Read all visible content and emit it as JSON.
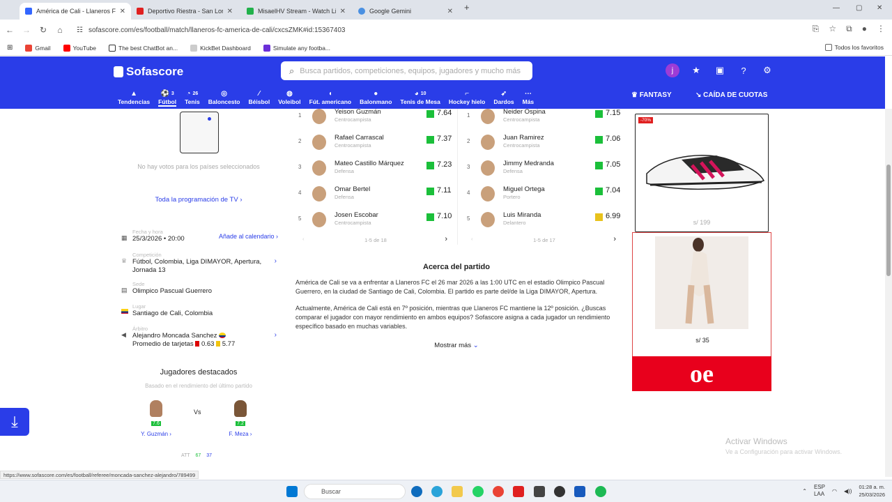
{
  "browser": {
    "tabs": [
      {
        "title": "América de Cali - Llaneros FC e",
        "color": "#3366ff",
        "active": true
      },
      {
        "title": "Deportivo Riestra - San Lorenzo",
        "color": "#e02020",
        "active": false
      },
      {
        "title": "MisaelHV Stream - Watch Live",
        "color": "#21b14b",
        "active": false
      },
      {
        "title": "Google Gemini",
        "color": "#4a90e2",
        "active": false
      }
    ],
    "url": "sofascore.com/es/football/match/llaneros-fc-america-de-cali/cxcsZMK#id:15367403",
    "bookmarks": [
      "Gmail",
      "YouTube",
      "The best ChatBot an...",
      "KickBet Dashboard",
      "Simulate any footba..."
    ],
    "bookmarks_folder": "Todos los favoritos",
    "status_url": "https://www.sofascore.com/es/football/referee/moncada-sanchez-alejandro/789499"
  },
  "header": {
    "logo": "Sofascore",
    "search_placeholder": "Busca partidos, competiciones, equipos, jugadores y mucho más",
    "avatar_letter": "j",
    "sports": [
      {
        "label": "Tendencias",
        "count": ""
      },
      {
        "label": "Fútbol",
        "count": "3"
      },
      {
        "label": "Tenis",
        "count": "26"
      },
      {
        "label": "Baloncesto",
        "count": ""
      },
      {
        "label": "Béisbol",
        "count": ""
      },
      {
        "label": "Voleibol",
        "count": ""
      },
      {
        "label": "Fút. americano",
        "count": ""
      },
      {
        "label": "Balonmano",
        "count": ""
      },
      {
        "label": "Tenis de Mesa",
        "count": "10"
      },
      {
        "label": "Hockey hielo",
        "count": ""
      },
      {
        "label": "Dardos",
        "count": ""
      },
      {
        "label": "Más",
        "count": ""
      }
    ],
    "fantasy": "FANTASY",
    "odds": "CAÍDA DE CUOTAS"
  },
  "left": {
    "no_votes": "No hay votos para los países seleccionados",
    "tv_link": "Toda la programación de TV",
    "date_label": "Fecha y hora",
    "date_value": "25/3/2026 • 20:00",
    "add_calendar": "Añade al calendario",
    "competition_label": "Competición",
    "competition_value": "Fútbol, Colombia, Liga DIMAYOR, Apertura, Jornada 13",
    "venue_label": "Sede",
    "venue_value": "Olimpico Pascual Guerrero",
    "place_label": "Lugar",
    "place_value": "Santiago de Cali, Colombia",
    "referee_label": "Árbitro",
    "referee_value": "Alejandro Moncada Sanchez",
    "cards_label": "Promedio de tarjetas",
    "red_cards": "0.63",
    "yellow_cards": "5.77",
    "featured_title": "Jugadores destacados",
    "featured_sub": "Basado en el rendimiento del último partido",
    "vs": "Vs",
    "player1": {
      "name": "Y. Guzmán",
      "rating": "7.6"
    },
    "player2": {
      "name": "F. Meza",
      "rating": "7.2"
    },
    "att": "ATT",
    "att_values": [
      "67",
      "37"
    ]
  },
  "ratings": {
    "home": [
      {
        "rank": "1",
        "name": "Yeison Guzmán",
        "pos": "Centrocampista",
        "score": "7.64",
        "color": "#1bbf3a"
      },
      {
        "rank": "2",
        "name": "Rafael Carrascal",
        "pos": "Centrocampista",
        "score": "7.37",
        "color": "#1bbf3a"
      },
      {
        "rank": "3",
        "name": "Mateo Castillo Márquez",
        "pos": "Defensa",
        "score": "7.23",
        "color": "#1bbf3a"
      },
      {
        "rank": "4",
        "name": "Omar Bertel",
        "pos": "Defensa",
        "score": "7.11",
        "color": "#1bbf3a"
      },
      {
        "rank": "5",
        "name": "Josen Escobar",
        "pos": "Centrocampista",
        "score": "7.10",
        "color": "#1bbf3a"
      }
    ],
    "away": [
      {
        "rank": "1",
        "name": "Neider Ospina",
        "pos": "Centrocampista",
        "score": "7.15",
        "color": "#1bbf3a"
      },
      {
        "rank": "2",
        "name": "Juan Ramirez",
        "pos": "Centrocampista",
        "score": "7.06",
        "color": "#1bbf3a"
      },
      {
        "rank": "3",
        "name": "Jimmy Medranda",
        "pos": "Defensa",
        "score": "7.05",
        "color": "#1bbf3a"
      },
      {
        "rank": "4",
        "name": "Miguel Ortega",
        "pos": "Portero",
        "score": "7.04",
        "color": "#1bbf3a"
      },
      {
        "rank": "5",
        "name": "Luis Miranda",
        "pos": "Delantero",
        "score": "6.99",
        "color": "#e8c21c"
      }
    ],
    "home_pager": "1-5 de 18",
    "away_pager": "1-5 de 17"
  },
  "about": {
    "title": "Acerca del partido",
    "p1": "América de Cali se va a enfrentar a Llaneros FC el 26 mar 2026 a las 1:00 UTC en el estadio Olimpico Pascual Guerrero, en la ciudad de Santiago de Cali, Colombia. El partido es parte del/de la Liga DIMAYOR, Apertura.",
    "p2": "Actualmente, América de Cali está en 7º posición, mientras que Llaneros FC mantiene la 12º posición. ¿Buscas comparar el jugador con mayor rendimiento en ambos equipos? Sofascore asigna a cada jugador un rendimiento específico basado en muchas variables.",
    "more": "Mostrar más"
  },
  "ads": {
    "discount": "-70%",
    "price1": "s/ 199",
    "price2": "s/ 35",
    "brand": "oe"
  },
  "windows": {
    "activate_title": "Activar Windows",
    "activate_sub": "Ve a Configuración para activar Windows.",
    "search": "Buscar",
    "lang": "ESP",
    "lang2": "LAA",
    "time": "01:28 a. m.",
    "date": "25/03/2026"
  }
}
